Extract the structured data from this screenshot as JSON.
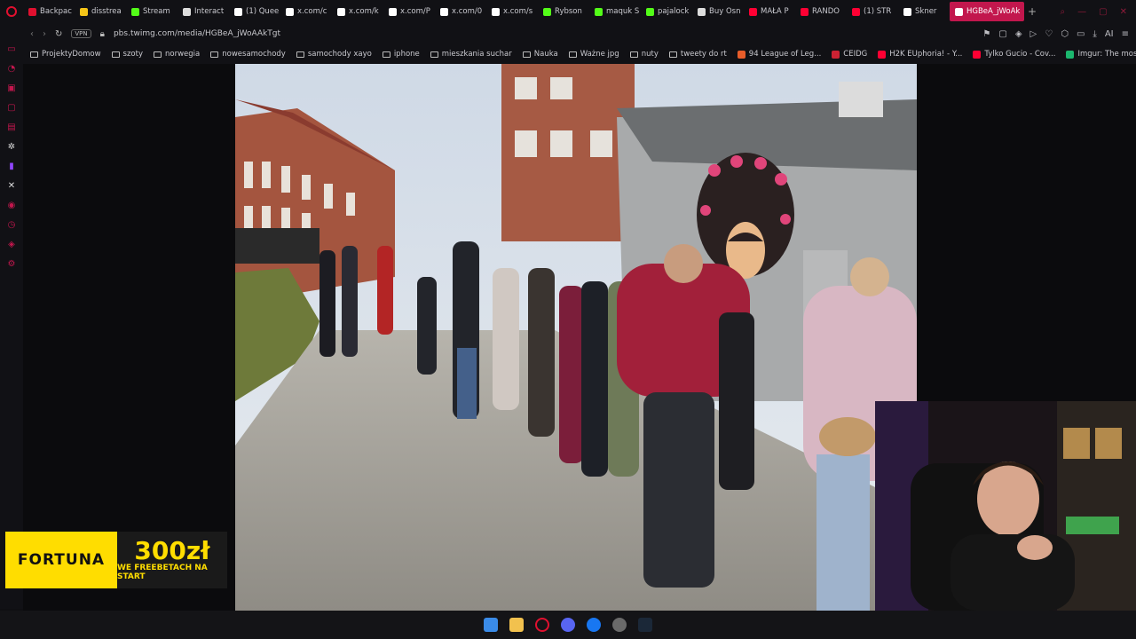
{
  "browser": {
    "tabs": [
      {
        "label": "Backpac",
        "icon": "red-heart-icon",
        "color": "#e0102f"
      },
      {
        "label": "disstrea",
        "icon": "kick-icon",
        "color": "#f5c518"
      },
      {
        "label": "Stream",
        "icon": "kick-icon",
        "color": "#53fc18"
      },
      {
        "label": "Interact",
        "icon": "github-icon",
        "color": "#dddddd"
      },
      {
        "label": "(1) Quee",
        "icon": "x-icon",
        "color": "#ffffff"
      },
      {
        "label": "x.com/c",
        "icon": "x-icon",
        "color": "#ffffff"
      },
      {
        "label": "x.com/k",
        "icon": "x-icon",
        "color": "#ffffff"
      },
      {
        "label": "x.com/P",
        "icon": "x-icon",
        "color": "#ffffff"
      },
      {
        "label": "x.com/0",
        "icon": "x-icon",
        "color": "#ffffff"
      },
      {
        "label": "x.com/s",
        "icon": "x-icon",
        "color": "#ffffff"
      },
      {
        "label": "Rybson",
        "icon": "kick-icon",
        "color": "#53fc18"
      },
      {
        "label": "maquk S",
        "icon": "kick-icon",
        "color": "#53fc18"
      },
      {
        "label": "pajalock",
        "icon": "kick-icon",
        "color": "#53fc18"
      },
      {
        "label": "Buy Osn",
        "icon": "steam-icon",
        "color": "#dddddd"
      },
      {
        "label": "MAŁA P",
        "icon": "youtube-icon",
        "color": "#ff0033"
      },
      {
        "label": "RANDO",
        "icon": "youtube-icon",
        "color": "#ff0033"
      },
      {
        "label": "(1) STR",
        "icon": "youtube-icon",
        "color": "#ff0033"
      },
      {
        "label": "Skner",
        "icon": "x-icon",
        "color": "#ffffff"
      },
      {
        "label": "HGBeA_jWoAk",
        "icon": "x-icon",
        "color": "#ffffff",
        "active": true
      }
    ],
    "url": "pbs.twimg.com/media/HGBeA_jWoAAkTgt",
    "vpn_label": "VPN",
    "bookmarks": [
      {
        "label": "ProjektyDomow",
        "type": "folder"
      },
      {
        "label": "szoty",
        "type": "folder"
      },
      {
        "label": "norwegia",
        "type": "folder"
      },
      {
        "label": "nowesamochody",
        "type": "folder"
      },
      {
        "label": "samochody xayo",
        "type": "folder"
      },
      {
        "label": "iphone",
        "type": "folder"
      },
      {
        "label": "mieszkania suchar",
        "type": "folder"
      },
      {
        "label": "Nauka",
        "type": "folder"
      },
      {
        "label": "Ważne jpg",
        "type": "folder"
      },
      {
        "label": "nuty",
        "type": "folder"
      },
      {
        "label": "tweety do rt",
        "type": "folder"
      },
      {
        "label": "94 League of Leg...",
        "type": "site",
        "color": "#e85d2a"
      },
      {
        "label": "CEIDG",
        "type": "site",
        "color": "#cc2233"
      },
      {
        "label": "H2K EUphoria! - Y...",
        "type": "site",
        "color": "#ff0033"
      },
      {
        "label": "Tylko Gucio - Cov...",
        "type": "site",
        "color": "#ff0033"
      },
      {
        "label": "Imgur: The most a...",
        "type": "site",
        "color": "#1bb76e"
      }
    ],
    "ai_label": "AI"
  },
  "overlay": {
    "ad_brand": "FORTUNA",
    "ad_amount": "300zł",
    "ad_tagline": "WE FREEBETACH NA START"
  }
}
